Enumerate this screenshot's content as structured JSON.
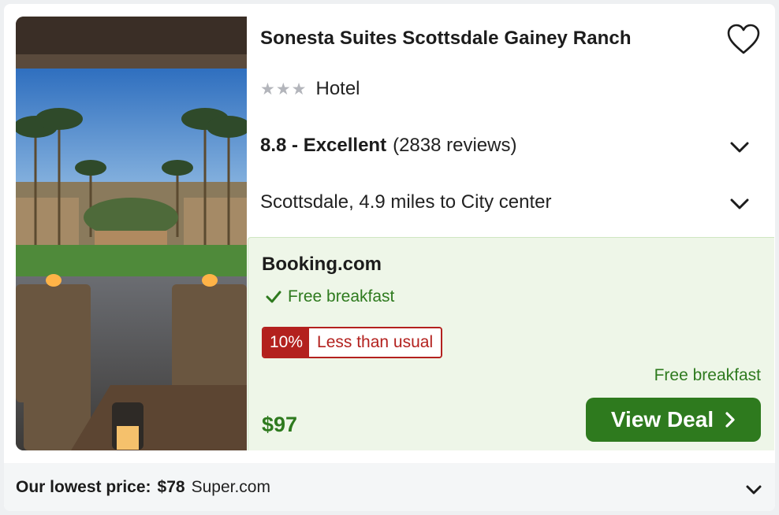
{
  "hotel": {
    "name": "Sonesta Suites Scottsdale Gainey Ranch",
    "star_count": 3,
    "type": "Hotel",
    "rating_text": "8.8 - Excellent",
    "reviews_text": "(2838 reviews)",
    "location": "Scottsdale, 4.9 miles to City center"
  },
  "deal": {
    "provider": "Booking.com",
    "feature": "Free breakfast",
    "badge_percent": "10%",
    "badge_text": "Less than usual",
    "price": "$97",
    "price_feature": "Free breakfast",
    "cta": "View Deal"
  },
  "footer": {
    "label": "Our lowest price:",
    "price": "$78",
    "provider": "Super.com"
  },
  "icons": {
    "favorite": "heart-icon",
    "expand": "chevron-down-icon",
    "feature": "check-icon",
    "cta": "chevron-right-icon"
  },
  "colors": {
    "accent_green": "#2e7a1e",
    "deal_background": "#eef6e8",
    "badge_red": "#b3211e",
    "star_gray": "#b3b5bb"
  }
}
